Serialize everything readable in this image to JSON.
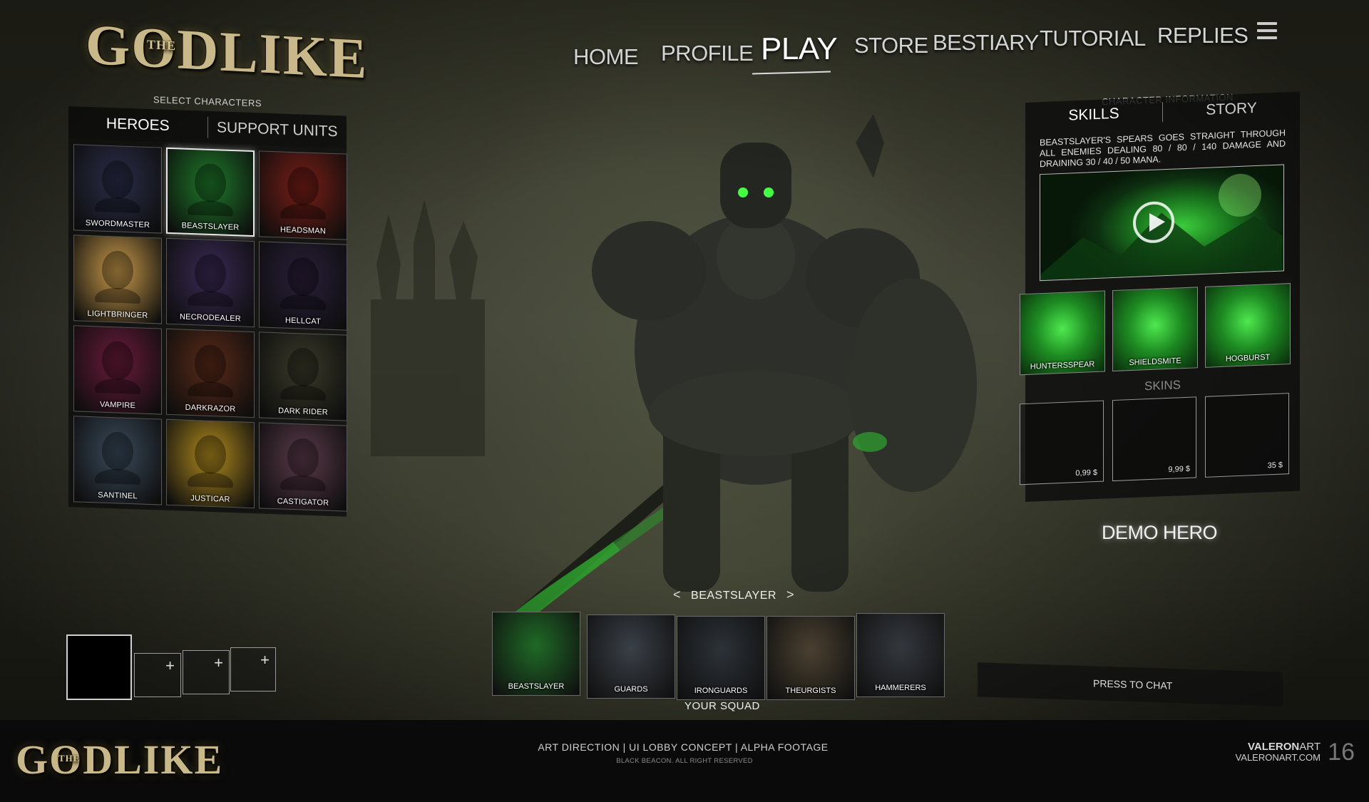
{
  "game": {
    "logo_main": "GODLIKE",
    "logo_the": "THE"
  },
  "nav": {
    "items": [
      "HOME",
      "PROFILE",
      "PLAY",
      "STORE",
      "BESTIARY",
      "TUTORIAL",
      "REPLIES"
    ],
    "active": "PLAY"
  },
  "left_panel": {
    "caption": "SELECT CHARACTERS",
    "tabs": [
      "HEROES",
      "SUPPORT UNITS"
    ],
    "active_tab": "HEROES",
    "characters": [
      {
        "name": "SWORDMASTER",
        "color": "#2a2e4a"
      },
      {
        "name": "BEASTSLAYER",
        "color": "#1f7a2a",
        "selected": true
      },
      {
        "name": "HEADSMAN",
        "color": "#7a1e16"
      },
      {
        "name": "LIGHTBRINGER",
        "color": "#c99a4a"
      },
      {
        "name": "NECRODEALER",
        "color": "#3a2a55"
      },
      {
        "name": "HELLCAT",
        "color": "#2a1f3a"
      },
      {
        "name": "VAMPIRE",
        "color": "#6a1a3a"
      },
      {
        "name": "DARKRAZOR",
        "color": "#5a2a18"
      },
      {
        "name": "DARK RIDER",
        "color": "#3a3a2a"
      },
      {
        "name": "SANTINEL",
        "color": "#3a4a5a"
      },
      {
        "name": "JUSTICAR",
        "color": "#b08a1e"
      },
      {
        "name": "CASTIGATOR",
        "color": "#5a3a4a"
      }
    ]
  },
  "squad": {
    "current": "BEASTSLAYER",
    "units": [
      {
        "name": "BEASTSLAYER",
        "color": "#1f6a26"
      },
      {
        "name": "GUARDS",
        "color": "#3a4048"
      },
      {
        "name": "IRONGUARDS",
        "color": "#2c3238"
      },
      {
        "name": "THEURGISTS",
        "color": "#4a4030"
      },
      {
        "name": "HAMMERERS",
        "color": "#34383e"
      }
    ],
    "label": "YOUR SQUAD",
    "slot_plus": "+"
  },
  "right_panel": {
    "caption": "CHARACTER INFORMATION",
    "tabs": [
      "SKILLS",
      "STORY"
    ],
    "active_tab": "SKILLS",
    "skill_description": "BEASTSLAYER'S SPEARS GOES STRAIGHT THROUGH ALL ENEMIES DEALING 80 / 80 / 140 DAMAGE AND DRAINING 30 / 40 / 50 MANA.",
    "skills": [
      "HUNTERSSPEAR",
      "SHIELDSMITE",
      "HOGBURST"
    ],
    "skins_title": "SKINS",
    "skins": [
      {
        "price": "0,99 $"
      },
      {
        "price": "9,99 $"
      },
      {
        "price": "35 $"
      }
    ],
    "demo_label": "DEMO HERO"
  },
  "chat": {
    "label": "PRESS TO CHAT"
  },
  "footer": {
    "credit_line": "ART DIRECTION | UI LOBBY CONCEPT | ALPHA FOOTAGE",
    "copyright": "BLACK BEACON. ALL RIGHT RESERVED",
    "brand_bold": "VALERON",
    "brand_rest": "ART",
    "brand_url": "VALERONART.COM",
    "page_number": "16"
  },
  "colors": {
    "accent_green": "#3ccb3c",
    "panel_bg": "#0c0c0c"
  }
}
